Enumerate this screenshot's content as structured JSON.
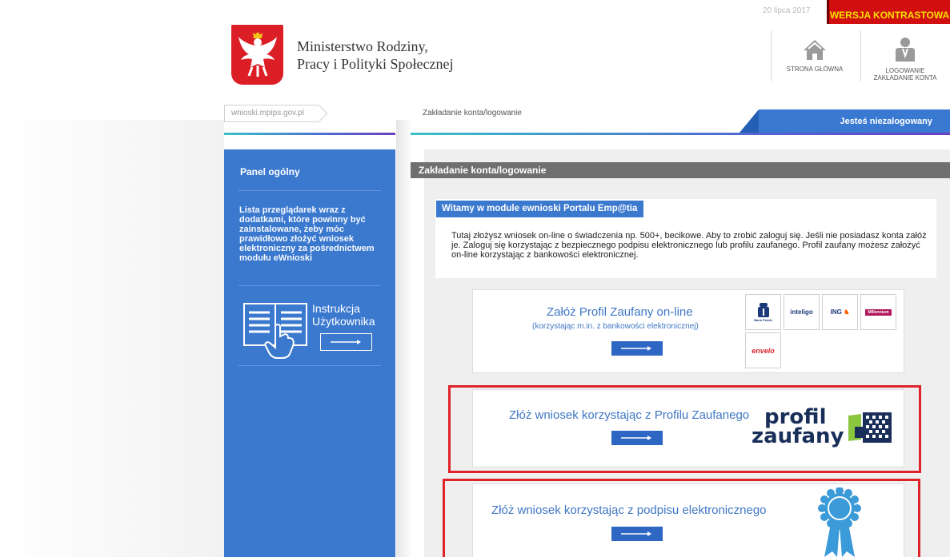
{
  "top": {
    "date": "20 lipca 2017",
    "contrast_label": "WERSJA KONTRASTOWA"
  },
  "brand": {
    "ministry_line1": "Ministerstwo Rodziny,",
    "ministry_line2": "Pracy i Polityki Społecznej"
  },
  "nav": {
    "home_label": "STRONA GŁÓWNA",
    "login_line1": "LOGOWANIE",
    "login_line2": "ZAKŁADANIE KONTA"
  },
  "breadcrumb": {
    "site": "wnioski.mpips.gov.pl",
    "page": "Zakładanie konta/logowanie"
  },
  "status": {
    "label": "Jesteś niezalogowany"
  },
  "sidebar": {
    "title": "Panel ogólny",
    "browsers_text": "Lista przeglądarek wraz z dodatkami, które powinny być zainstalowane, żeby móc prawidłowo złożyć wniosek elektroniczny za pośrednictwem modułu eWnioski",
    "manual_line1": "Instrukcja",
    "manual_line2": "Użytkownika"
  },
  "main": {
    "header": "Zakładanie konta/logowanie",
    "welcome_title": "Witamy w module ewnioski Portalu Emp@tia",
    "welcome_text": "Tutaj złożysz wniosek on-line o świadczenia np. 500+, becikowe. Aby to zrobić zaloguj się. Jeśli nie posiadasz konta załóż je. Zaloguj się korzystając z bezpiecznego podpisu elektronicznego lub profilu zaufanego. Profil zaufany możesz założyć on-line korzystając z bankowości elektronicznej.",
    "create_pz_title": "Załóż Profil Zaufany on-line",
    "create_pz_sub": "(korzystając m.in. z bankowości elektronicznej)",
    "banks": [
      {
        "name": "Bank Polski",
        "color": "#1c3a7a"
      },
      {
        "name": "inteligo",
        "color": "#1c3a7a"
      },
      {
        "name": "ING",
        "color": "#ff6200"
      },
      {
        "name": "Millennium",
        "color": "#b0175c"
      },
      {
        "name": "envelo",
        "color": "#d8262e"
      }
    ],
    "sign_pz_title": "Złóż wniosek korzystając z Profilu Zaufanego",
    "pz_logo_line1": "profil",
    "pz_logo_line2": "zaufany",
    "sign_e_title": "Złóż wniosek korzystając z podpisu elektronicznego"
  },
  "colors": {
    "accent_blue": "#3b79cf",
    "highlight_red": "#e0222a",
    "contrast_bg": "#d20f0f"
  }
}
